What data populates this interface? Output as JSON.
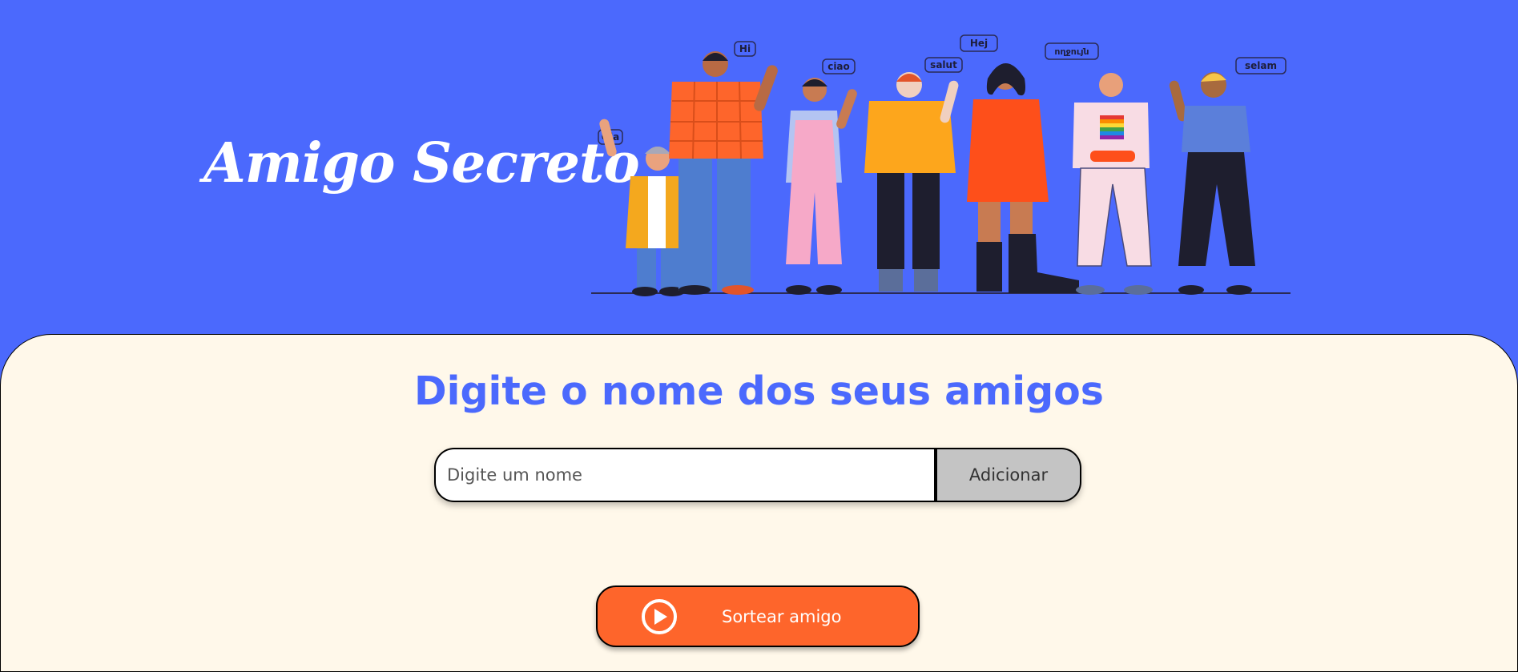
{
  "header": {
    "title": "Amigo Secreto",
    "illustration": {
      "icon": "people-waving-illustration",
      "greetings": [
        "Ola",
        "Hi",
        "ciao",
        "salut",
        "Hej",
        "ողջույն",
        "selam"
      ]
    }
  },
  "main": {
    "section_title": "Digite o nome dos seus amigos",
    "name_input": {
      "value": "",
      "placeholder": "Digite um nome"
    },
    "add_button_label": "Adicionar",
    "draw_button": {
      "label": "Sortear amigo",
      "icon": "play-circle-icon"
    }
  },
  "colors": {
    "banner_background": "#4B69FD",
    "content_background": "#FFF8EA",
    "title_accent": "#4B69FD",
    "draw_button": "#FE652B",
    "add_button": "#C4C4C4"
  }
}
